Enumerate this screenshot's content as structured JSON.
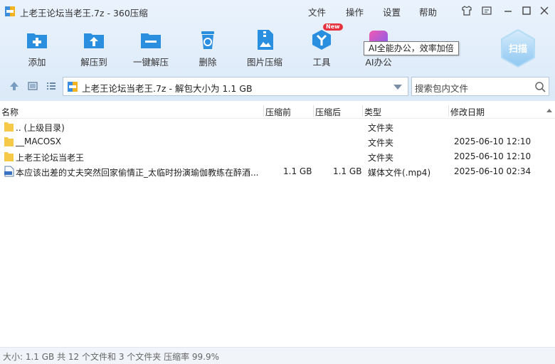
{
  "window": {
    "title": "上老王论坛当老王.7z - 360压缩",
    "menu": [
      "文件",
      "操作",
      "设置",
      "帮助"
    ]
  },
  "toolbar": {
    "buttons": [
      {
        "label": "添加",
        "icon": "add-folder-icon"
      },
      {
        "label": "解压到",
        "icon": "extract-folder-icon"
      },
      {
        "label": "一键解压",
        "icon": "one-click-extract-icon"
      },
      {
        "label": "删除",
        "icon": "recycle-bin-icon"
      },
      {
        "label": "图片压缩",
        "icon": "image-compress-icon"
      },
      {
        "label": "工具",
        "icon": "tools-icon"
      },
      {
        "label": "AI办公",
        "icon": "ai-office-icon"
      }
    ],
    "new_badge": "New",
    "ai_tooltip": "AI全能办公，效率加倍",
    "scan_label": "扫描"
  },
  "pathbar": {
    "text": "上老王论坛当老王.7z - 解包大小为 1.1 GB",
    "search_placeholder": "搜索包内文件"
  },
  "columns": {
    "name": "名称",
    "compressed_before": "压缩前",
    "compressed_after": "压缩后",
    "type": "类型",
    "modified": "修改日期"
  },
  "files": [
    {
      "name": ".. (上级目录)",
      "before": "",
      "after": "",
      "type": "文件夹",
      "modified": "",
      "icon": "folder-icon"
    },
    {
      "name": "__MACOSX",
      "before": "",
      "after": "",
      "type": "文件夹",
      "modified": "2025-06-10 12:10",
      "icon": "folder-icon"
    },
    {
      "name": "上老王论坛当老王",
      "before": "",
      "after": "",
      "type": "文件夹",
      "modified": "2025-06-10 12:10",
      "icon": "folder-icon"
    },
    {
      "name": "本应该出差的丈夫突然回家偷情正_太临时扮演瑜伽教练在醉酒...",
      "before": "1.1 GB",
      "after": "1.1 GB",
      "type": "媒体文件(.mp4)",
      "modified": "2025-06-10 02:34",
      "icon": "mp4-file-icon"
    }
  ],
  "status": "大小: 1.1 GB 共 12 个文件和 3 个文件夹 压缩率 99.9%",
  "colors": {
    "accent": "#2b8fe0",
    "folder": "#f7c948",
    "badge": "#e5323e"
  }
}
